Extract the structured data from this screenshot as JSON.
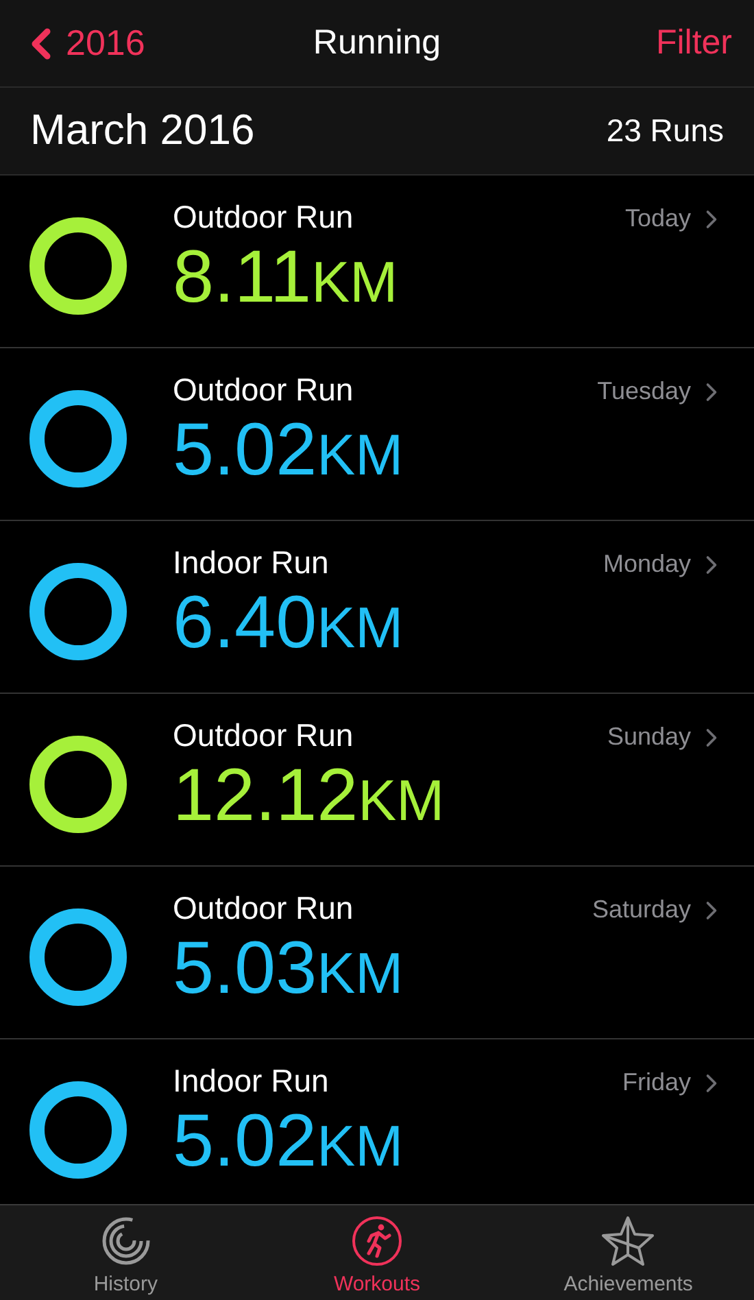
{
  "nav": {
    "back": "2016",
    "title": "Running",
    "action": "Filter"
  },
  "section": {
    "title": "March 2016",
    "count": "23 Runs"
  },
  "workouts": [
    {
      "name": "Outdoor Run",
      "value": "8.11",
      "unit": "KM",
      "day": "Today",
      "color": "#a6f03a"
    },
    {
      "name": "Outdoor Run",
      "value": "5.02",
      "unit": "KM",
      "day": "Tuesday",
      "color": "#22c0f5"
    },
    {
      "name": "Indoor Run",
      "value": "6.40",
      "unit": "KM",
      "day": "Monday",
      "color": "#22c0f5"
    },
    {
      "name": "Outdoor Run",
      "value": "12.12",
      "unit": "KM",
      "day": "Sunday",
      "color": "#a6f03a"
    },
    {
      "name": "Outdoor Run",
      "value": "5.03",
      "unit": "KM",
      "day": "Saturday",
      "color": "#22c0f5"
    },
    {
      "name": "Indoor Run",
      "value": "5.02",
      "unit": "KM",
      "day": "Friday",
      "color": "#22c0f5"
    }
  ],
  "tabs": [
    {
      "label": "History",
      "kind": "history",
      "selected": false
    },
    {
      "label": "Workouts",
      "kind": "workouts",
      "selected": true
    },
    {
      "label": "Achievements",
      "kind": "achievements",
      "selected": false
    }
  ]
}
